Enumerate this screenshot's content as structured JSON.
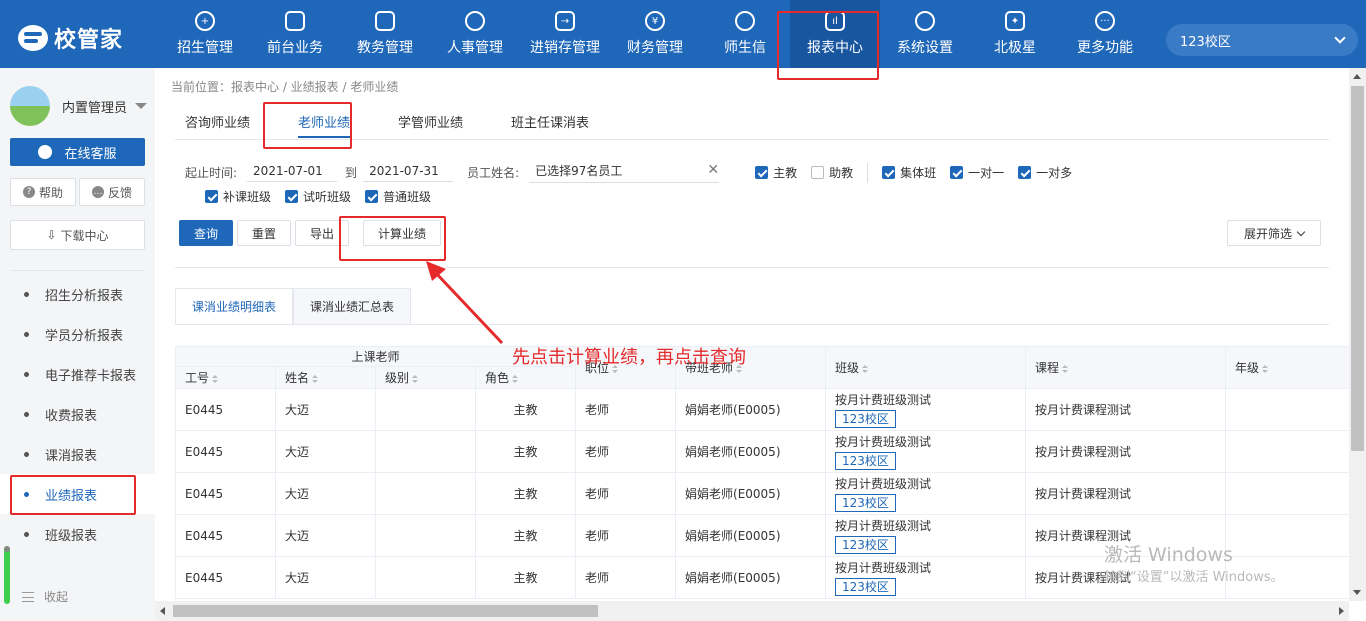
{
  "app": {
    "logo": "校管家"
  },
  "nav": {
    "items": [
      {
        "label": "招生管理",
        "glyph": "+"
      },
      {
        "label": "前台业务",
        "glyph": ""
      },
      {
        "label": "教务管理",
        "glyph": ""
      },
      {
        "label": "人事管理",
        "glyph": ""
      },
      {
        "label": "进销存管理",
        "glyph": "→"
      },
      {
        "label": "财务管理",
        "glyph": "¥"
      },
      {
        "label": "师生信",
        "glyph": ""
      },
      {
        "label": "报表中心",
        "glyph": "ıl"
      },
      {
        "label": "系统设置",
        "glyph": ""
      },
      {
        "label": "北极星",
        "glyph": "✦"
      },
      {
        "label": "更多功能",
        "glyph": "···"
      }
    ],
    "campus": "123校区"
  },
  "sidebar": {
    "username": "内置管理员",
    "online_service": "在线客服",
    "help": "帮助",
    "feedback": "反馈",
    "download": "下载中心",
    "menu": [
      "招生分析报表",
      "学员分析报表",
      "电子推荐卡报表",
      "收费报表",
      "课消报表",
      "业绩报表",
      "班级报表"
    ],
    "collapse": "收起"
  },
  "breadcrumb": "当前位置：报表中心 / 业绩报表 / 老师业绩",
  "tabs": [
    "咨询师业绩",
    "老师业绩",
    "学管师业绩",
    "班主任课消表"
  ],
  "filters": {
    "start_label": "起止时间:",
    "start_date": "2021-07-01",
    "to": "到",
    "end_date": "2021-07-31",
    "staff_label": "员工姓名:",
    "staff_value": "已选择97名员工",
    "clear": "✕",
    "checks_row1": [
      {
        "label": "主教",
        "checked": true
      },
      {
        "label": "助教",
        "checked": false
      },
      {
        "label": "集体班",
        "checked": true
      },
      {
        "label": "一对一",
        "checked": true
      },
      {
        "label": "一对多",
        "checked": true
      }
    ],
    "checks_row2": [
      {
        "label": "补课班级",
        "checked": true
      },
      {
        "label": "试听班级",
        "checked": true
      },
      {
        "label": "普通班级",
        "checked": true
      }
    ]
  },
  "actions": {
    "query": "查询",
    "reset": "重置",
    "export": "导出",
    "calc": "计算业绩",
    "expand": "展开筛选"
  },
  "subtabs": [
    "课消业绩明细表",
    "课消业绩汇总表"
  ],
  "table": {
    "group_header": "上课老师",
    "headers": [
      "工号",
      "姓名",
      "级别",
      "角色",
      "职位",
      "带班老师",
      "班级",
      "课程",
      "年级"
    ],
    "rows": [
      {
        "id": "E0445",
        "name": "大迈",
        "level": "",
        "role": "主教",
        "position": "老师",
        "class_teacher": "娟娟老师(E0005)",
        "class": "按月计费班级测试",
        "campus": "123校区",
        "course": "按月计费课程测试",
        "grade": ""
      },
      {
        "id": "E0445",
        "name": "大迈",
        "level": "",
        "role": "主教",
        "position": "老师",
        "class_teacher": "娟娟老师(E0005)",
        "class": "按月计费班级测试",
        "campus": "123校区",
        "course": "按月计费课程测试",
        "grade": ""
      },
      {
        "id": "E0445",
        "name": "大迈",
        "level": "",
        "role": "主教",
        "position": "老师",
        "class_teacher": "娟娟老师(E0005)",
        "class": "按月计费班级测试",
        "campus": "123校区",
        "course": "按月计费课程测试",
        "grade": ""
      },
      {
        "id": "E0445",
        "name": "大迈",
        "level": "",
        "role": "主教",
        "position": "老师",
        "class_teacher": "娟娟老师(E0005)",
        "class": "按月计费班级测试",
        "campus": "123校区",
        "course": "按月计费课程测试",
        "grade": ""
      },
      {
        "id": "E0445",
        "name": "大迈",
        "level": "",
        "role": "主教",
        "position": "老师",
        "class_teacher": "娟娟老师(E0005)",
        "class": "按月计费班级测试",
        "campus": "123校区",
        "course": "按月计费课程测试",
        "grade": ""
      }
    ]
  },
  "annotation": "先点击计算业绩，再点击查询",
  "watermark": {
    "line1": "激活 Windows",
    "line2": "转到“设置”以激活 Windows。"
  },
  "colors": {
    "primary": "#1f67b8",
    "highlight": "#e42a2a"
  }
}
